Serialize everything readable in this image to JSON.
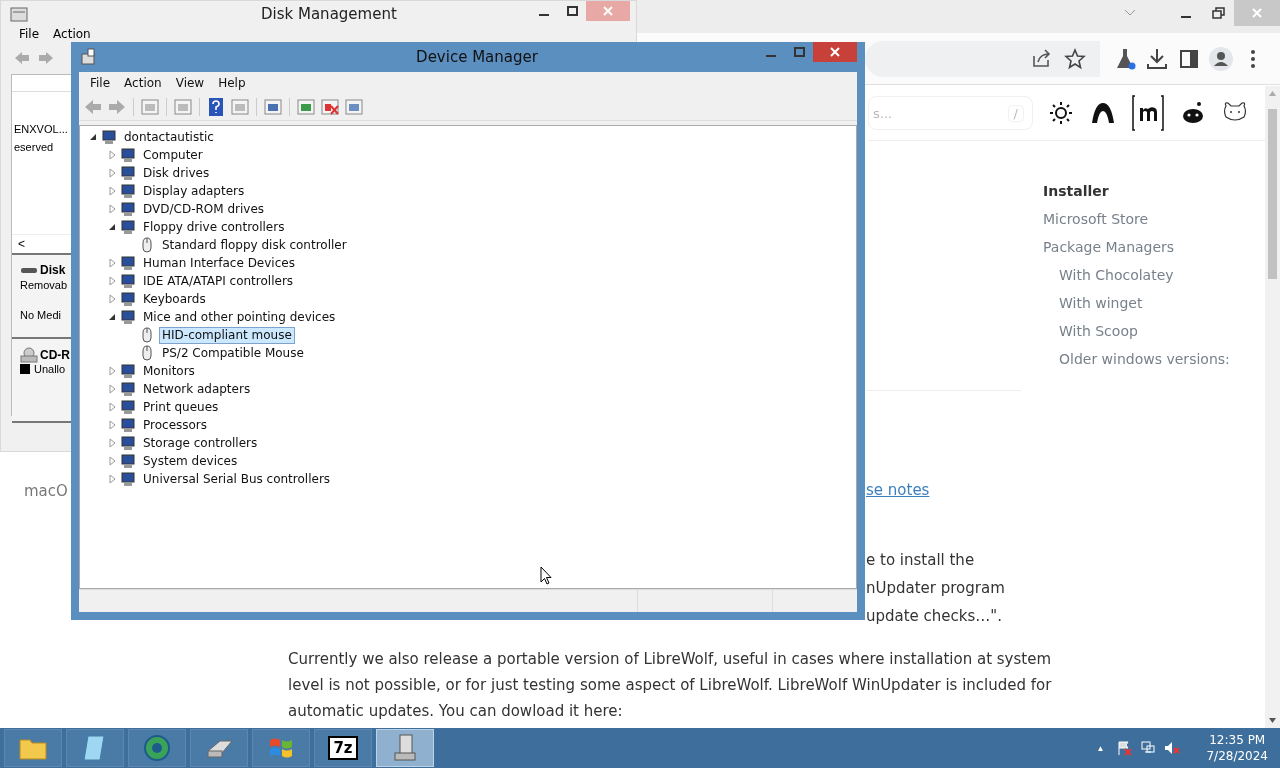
{
  "browser": {
    "search": {
      "placeholder": "s...",
      "shortcut": "/"
    },
    "toc": [
      {
        "label": "Installer",
        "selected": true
      },
      {
        "label": "Microsoft Store",
        "selected": false
      },
      {
        "label": "Package Managers",
        "selected": false,
        "children": [
          {
            "label": "With Chocolatey",
            "selected": false
          },
          {
            "label": "With winget",
            "selected": false
          },
          {
            "label": "With Scoop",
            "selected": false
          },
          {
            "label": "Older windows versions:",
            "selected": false
          }
        ]
      }
    ],
    "side_label": "macO",
    "link": "se notes",
    "fragments": [
      "e to install the",
      "nUpdater program",
      "update checks…\"."
    ],
    "paragraph": [
      "Currently we also release a portable version of LibreWolf, useful in cases where installation at system",
      "level is not possible, or for just testing some aspect of LibreWolf. LibreWolf WinUpdater is included for",
      "automatic updates. You can dowload it here:"
    ]
  },
  "disk_management": {
    "title": "Disk Management",
    "menu": [
      "File",
      "Action"
    ],
    "volumes": [
      "ENXVOL...",
      "eserved"
    ],
    "scroll_left": "<",
    "disks": [
      {
        "kind": "disk",
        "name": "Disk",
        "type": "Removab",
        "status": "No Medi"
      },
      {
        "kind": "cdrom",
        "name": "CD-R",
        "status": "Unallo"
      }
    ]
  },
  "device_manager": {
    "title": "Device Manager",
    "menu": [
      "File",
      "Action",
      "View",
      "Help"
    ],
    "tree": {
      "label": "dontactautistic",
      "expanded": true,
      "selected": false,
      "children": [
        {
          "label": "Computer",
          "expanded": false,
          "selected": false
        },
        {
          "label": "Disk drives",
          "expanded": false,
          "selected": false
        },
        {
          "label": "Display adapters",
          "expanded": false,
          "selected": false
        },
        {
          "label": "DVD/CD-ROM drives",
          "expanded": false,
          "selected": false
        },
        {
          "label": "Floppy drive controllers",
          "expanded": true,
          "selected": false,
          "children": [
            {
              "label": "Standard floppy disk controller",
              "selected": false
            }
          ]
        },
        {
          "label": "Human Interface Devices",
          "expanded": false,
          "selected": false
        },
        {
          "label": "IDE ATA/ATAPI controllers",
          "expanded": false,
          "selected": false
        },
        {
          "label": "Keyboards",
          "expanded": false,
          "selected": false
        },
        {
          "label": "Mice and other pointing devices",
          "expanded": true,
          "selected": false,
          "children": [
            {
              "label": "HID-compliant mouse",
              "selected": true
            },
            {
              "label": "PS/2 Compatible Mouse",
              "selected": false
            }
          ]
        },
        {
          "label": "Monitors",
          "expanded": false,
          "selected": false
        },
        {
          "label": "Network adapters",
          "expanded": false,
          "selected": false
        },
        {
          "label": "Print queues",
          "expanded": false,
          "selected": false
        },
        {
          "label": "Processors",
          "expanded": false,
          "selected": false
        },
        {
          "label": "Storage controllers",
          "expanded": false,
          "selected": false
        },
        {
          "label": "System devices",
          "expanded": false,
          "selected": false
        },
        {
          "label": "Universal Serial Bus controllers",
          "expanded": false,
          "selected": false
        }
      ]
    }
  },
  "taskbar": {
    "apps": [
      {
        "kind": "folder",
        "selected": false
      },
      {
        "kind": "notepad",
        "selected": false
      },
      {
        "kind": "globe",
        "selected": false
      },
      {
        "kind": "drive",
        "selected": false
      },
      {
        "kind": "windows",
        "selected": false
      },
      {
        "kind": "sevenzip",
        "label": "7z",
        "selected": false
      },
      {
        "kind": "device",
        "selected": true
      }
    ],
    "tray_arrow": "▲",
    "time": "12:35 PM",
    "date": "7/28/2024"
  }
}
